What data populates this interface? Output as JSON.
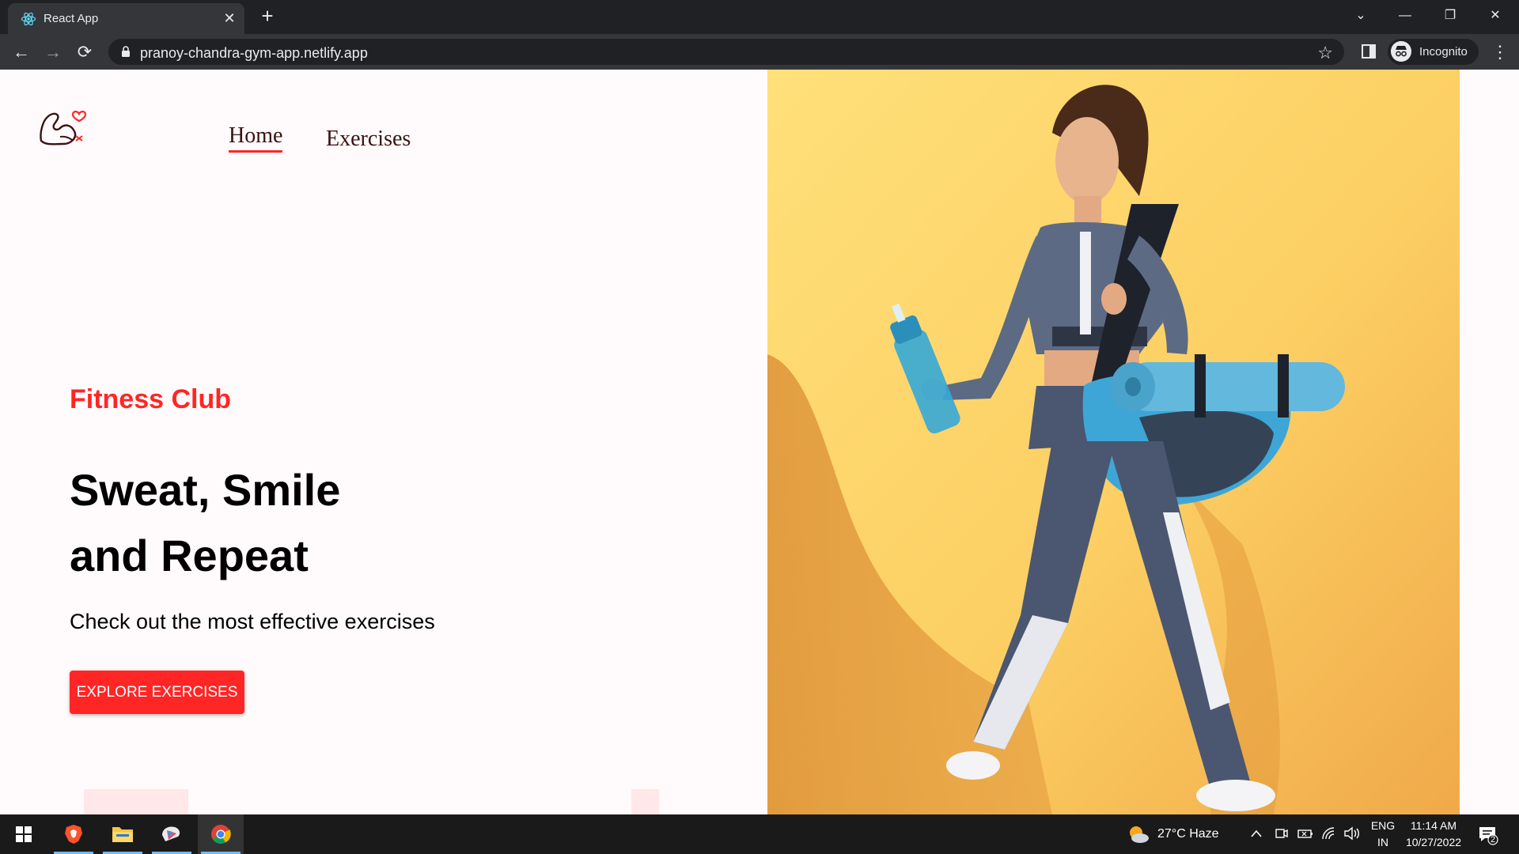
{
  "browser": {
    "tab_title": "React App",
    "tab_close": "✕",
    "new_tab": "+",
    "url": "pranoy-chandra-gym-app.netlify.app",
    "profile_label": "Incognito",
    "controls": {
      "tab_search": "⌄",
      "minimize": "—",
      "restore": "❐",
      "close": "✕"
    },
    "nav": {
      "back": "←",
      "forward": "→",
      "reload": "⟳",
      "star": "☆",
      "menu": "⋮"
    }
  },
  "site": {
    "nav": {
      "home": "Home",
      "exercises": "Exercises"
    },
    "hero": {
      "subtitle": "Fitness Club",
      "title_line1": "Sweat, Smile",
      "title_line2": "and Repeat",
      "description": "Check out the most effective exercises",
      "button": "Explore Exercises"
    },
    "colors": {
      "accent": "#ff2625",
      "background": "#fffafb",
      "image_bg": "#ffd36b"
    }
  },
  "taskbar": {
    "weather": "27°C  Haze",
    "language_top": "ENG",
    "language_bottom": "IN",
    "time": "11:14 AM",
    "date": "10/27/2022",
    "notifications": "2"
  }
}
